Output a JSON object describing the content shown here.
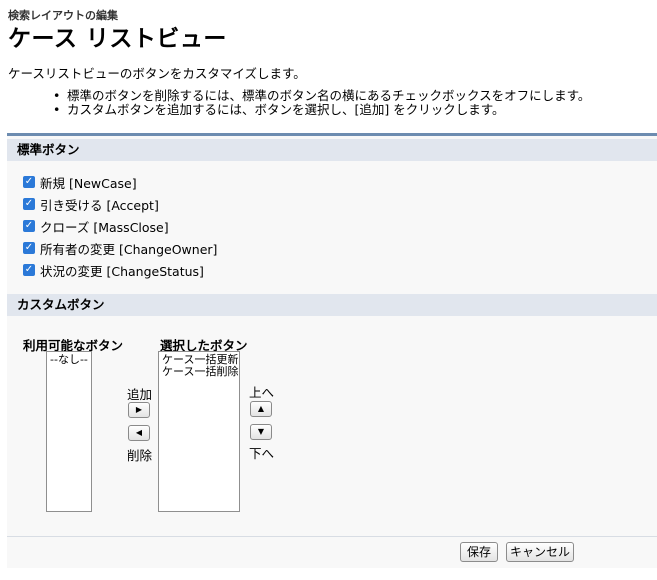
{
  "header": {
    "breadcrumb": "検索レイアウトの編集",
    "title": "ケース リストビュー"
  },
  "intro": "ケースリストビューのボタンをカスタマイズします。",
  "instructions": [
    "標準のボタンを削除するには、標準のボタン名の横にあるチェックボックスをオフにします。",
    "カスタムボタンを追加するには、ボタンを選択し、[追加] をクリックします。"
  ],
  "standard_buttons": {
    "title": "標準ボタン",
    "items": [
      {
        "label": "新規 [NewCase]",
        "checked": true
      },
      {
        "label": "引き受ける [Accept]",
        "checked": true
      },
      {
        "label": "クローズ [MassClose]",
        "checked": true
      },
      {
        "label": "所有者の変更 [ChangeOwner]",
        "checked": true
      },
      {
        "label": "状況の変更 [ChangeStatus]",
        "checked": true
      }
    ]
  },
  "custom_buttons": {
    "title": "カスタムボタン",
    "available_label": "利用可能なボタン",
    "available_options": [
      "--なし--"
    ],
    "selected_label": "選択したボタン",
    "selected_options": [
      "ケース一括更新",
      "ケース一括削除"
    ],
    "add_label": "追加",
    "remove_label": "削除",
    "up_label": "上へ",
    "down_label": "下へ"
  },
  "footer": {
    "save_label": "保存",
    "cancel_label": "キャンセル"
  },
  "colors": {
    "panel_border": "#6d8cb0",
    "section_header_bg": "#e1e6ee",
    "checkbox": "#2b79d8"
  }
}
